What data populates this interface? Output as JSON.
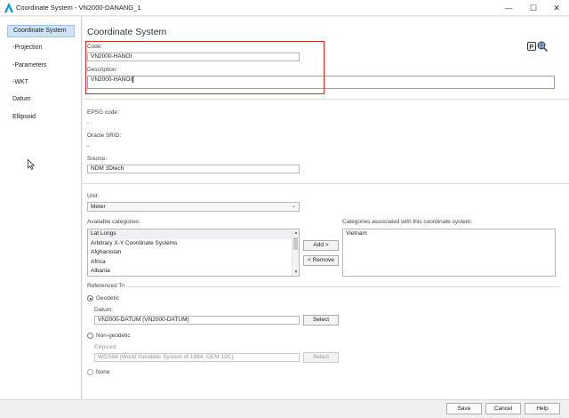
{
  "window": {
    "title": "Coordinate System - VN2000-DANANG_1",
    "minimize_glyph": "—",
    "maximize_glyph": "☐",
    "close_glyph": "✕"
  },
  "sidebar": {
    "items": [
      {
        "label": "Coordinate System",
        "active": true
      },
      {
        "label": "-Projection"
      },
      {
        "label": "-Parameters"
      },
      {
        "label": "-WKT"
      },
      {
        "label": "Datum"
      },
      {
        "label": "Ellipsoid"
      }
    ]
  },
  "main": {
    "title": "Coordinate System",
    "icons": [
      "postgis-icon",
      "globe-search-icon"
    ],
    "code": {
      "label": "Code:",
      "value": "VN2000-HANOI"
    },
    "description": {
      "label": "Description:",
      "value": "VN2000-HANOI"
    },
    "epsg": {
      "label": "EPSG code:",
      "value": "-"
    },
    "oracle": {
      "label": "Oracle SRID:",
      "value": "-"
    },
    "source": {
      "label": "Source:",
      "value": "NDM 3Dtech"
    },
    "unit": {
      "label": "Unit:",
      "value": "Meter"
    },
    "available_categories": {
      "label": "Available categories:",
      "items": [
        "Lat Longs",
        "Arbitrary X-Y Coordinate Systems",
        "Afghanistan",
        "Africa",
        "Albania"
      ]
    },
    "add_label": "Add >",
    "remove_label": "< Remove",
    "associated_categories": {
      "label": "Categories associated with this coordinate system:",
      "items": [
        "Vietnam"
      ]
    },
    "referenced_to": {
      "label": "Referenced To",
      "geodetic_label": "Geodetic",
      "datum_label": "Datum:",
      "datum_value": "VN2000-DATUM (VN2000-DATUM)",
      "select_label": "Select",
      "non_geodetic_label": "Non-geodetic",
      "ellipsoid_label": "Ellipsoid:",
      "ellipsoid_value": "WGS84 (World Geodetic System of 1984, GEM 10C)",
      "none_label": "None"
    }
  },
  "footer": {
    "save": "Save",
    "cancel": "Cancel",
    "help": "Help"
  }
}
